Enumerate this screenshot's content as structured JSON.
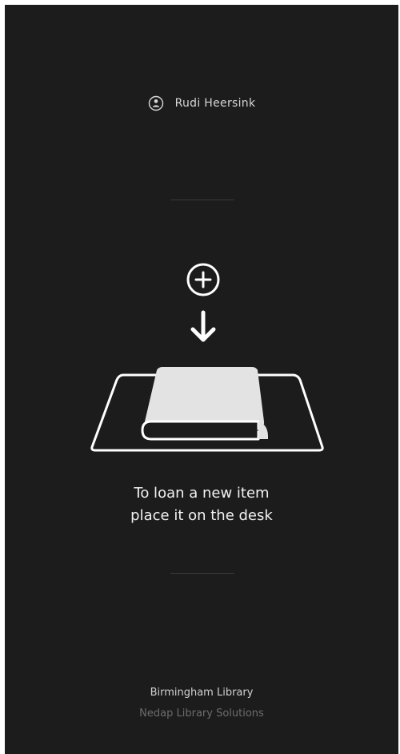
{
  "user": {
    "icon": "user-circle-icon",
    "name": "Rudi Heersink"
  },
  "illustration": {
    "add_icon": "plus-circle-icon",
    "arrow_icon": "arrow-down-icon",
    "desk_icon": "book-on-desk-icon"
  },
  "instruction": {
    "line1": "To loan a new item",
    "line2": "place it on the desk"
  },
  "footer": {
    "library": "Birmingham Library",
    "vendor": "Nedap Library Solutions"
  },
  "colors": {
    "background": "#1c1c1c",
    "foreground": "#ffffff",
    "muted": "#6c6c6c",
    "divider": "#3a3a3a"
  }
}
